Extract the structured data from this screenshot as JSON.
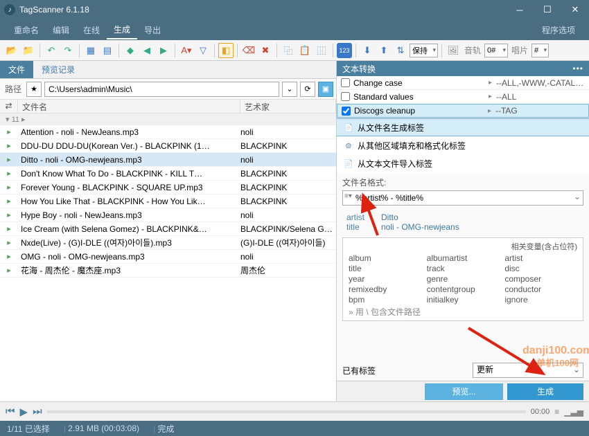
{
  "titlebar": {
    "title": "TagScanner 6.1.18"
  },
  "menu": {
    "items": [
      "重命名",
      "编辑",
      "在线",
      "生成",
      "导出"
    ],
    "active": 3,
    "right": "程序选项"
  },
  "toolbar": {
    "keep": "保持",
    "track_lbl": "音轨",
    "track_val": "0#",
    "disc_lbl": "唱片",
    "disc_val": "#"
  },
  "left": {
    "tabs": [
      "文件",
      "预览记录"
    ],
    "path_label": "路径",
    "path": "C:\\Users\\admin\\Music\\",
    "hdr_shuffle": "⇄",
    "hdr_file": "文件名",
    "hdr_artist": "艺术家",
    "group": "11 ▸",
    "rows": [
      {
        "f": "Attention - noli - NewJeans.mp3",
        "a": "noli"
      },
      {
        "f": "DDU-DU DDU-DU(Korean Ver.) - BLACKPINK (1…",
        "a": "BLACKPINK"
      },
      {
        "f": "Ditto - noli - OMG-newjeans.mp3",
        "a": "noli",
        "sel": true
      },
      {
        "f": "Don't Know What To Do - BLACKPINK - KILL T…",
        "a": "BLACKPINK"
      },
      {
        "f": "Forever Young - BLACKPINK - SQUARE UP.mp3",
        "a": "BLACKPINK"
      },
      {
        "f": "How You Like That - BLACKPINK - How You Lik…",
        "a": "BLACKPINK"
      },
      {
        "f": "Hype Boy - noli - NewJeans.mp3",
        "a": "noli"
      },
      {
        "f": "Ice Cream (with Selena Gomez) - BLACKPINK&…",
        "a": "BLACKPINK/Selena Gome"
      },
      {
        "f": "Nxde(Live) - (G)I-DLE ((여자)아이들).mp3",
        "a": "(G)I-DLE ((여자)아이들)"
      },
      {
        "f": "OMG - noli - OMG-newjeans.mp3",
        "a": "noli"
      },
      {
        "f": "花海 - 周杰伦 - 魔杰座.mp3",
        "a": "周杰伦"
      }
    ]
  },
  "right": {
    "transform_hdr": "文本转换",
    "transforms": [
      {
        "c": false,
        "n": "Change case",
        "v": "--ALL,-WWW,-CATAL…"
      },
      {
        "c": false,
        "n": "Standard values",
        "v": "--ALL"
      },
      {
        "c": true,
        "n": "Discogs cleanup",
        "v": "--TAG"
      }
    ],
    "modes": [
      {
        "icon": "📄",
        "label": "从文件名生成标签",
        "active": true
      },
      {
        "icon": "⊜",
        "label": "从其他区域填充和格式化标签"
      },
      {
        "icon": "📄",
        "label": "从文本文件导入标签"
      }
    ],
    "format_label": "文件名格式:",
    "format_value": "%artist% - %title%",
    "preview": [
      {
        "k": "artist",
        "v": "Ditto"
      },
      {
        "k": "title",
        "v": "noli - OMG-newjeans"
      }
    ],
    "vars_title": "相关变量(含占位符)",
    "vars": [
      "album",
      "albumartist",
      "artist",
      "title",
      "track",
      "disc",
      "year",
      "genre",
      "composer",
      "remixedby",
      "contentgroup",
      "conductor",
      "bpm",
      "initialkey",
      "ignore"
    ],
    "vars_note": "» 用 \\ 包含文件路径",
    "existing_label": "已有标签",
    "existing_value": "更新",
    "preview_btn": "预览...",
    "gen_btn": "生成"
  },
  "player": {
    "time": "00:00"
  },
  "status": {
    "sel": "1/11 已选择",
    "size": "2.91 MB (00:03:08)",
    "state": "完成"
  },
  "watermark": "danji100.com\n单机100网"
}
